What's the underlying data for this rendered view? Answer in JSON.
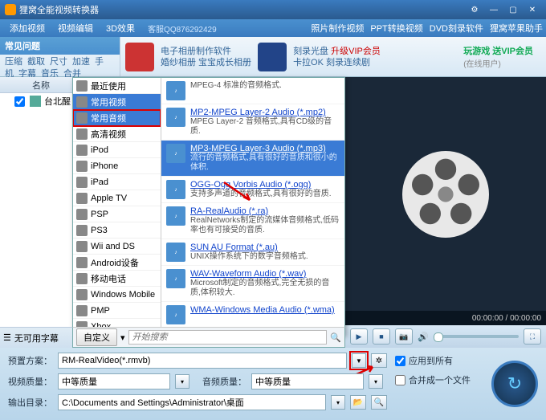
{
  "title": "狸窝全能视频转换器",
  "menu": {
    "addVideo": "添加视频",
    "videoEdit": "视频编辑",
    "effect3d": "3D效果"
  },
  "support": "客服QQ876292429",
  "topLinks": {
    "photo": "照片制作视频",
    "ppt": "PPT转换视频",
    "dvd": "DVD刻录软件",
    "apple": "狸窝苹果助手"
  },
  "faq": {
    "title": "常见问题",
    "items": [
      "压缩",
      "截取",
      "尺寸",
      "加速",
      "手机",
      "字幕",
      "音乐",
      "合并"
    ]
  },
  "promo1": {
    "line1": "电子相册制作软件",
    "line2": "婚纱相册  宝宝成长相册"
  },
  "promo2": {
    "line1": "刻录光盘",
    "vip": "升级VIP会员",
    "line2": "卡拉OK  刻录连续剧"
  },
  "promo3": {
    "line1": "玩游戏  送VIP会员",
    "line2": "(在线用户)"
  },
  "nameHeader": "名称",
  "fileItem": "台北醒",
  "categories": [
    {
      "label": "最近使用"
    },
    {
      "label": "常用视频",
      "hl": true
    },
    {
      "label": "常用音频",
      "hlRed": true
    },
    {
      "label": "高清视频"
    },
    {
      "label": "iPod"
    },
    {
      "label": "iPhone"
    },
    {
      "label": "iPad"
    },
    {
      "label": "Apple TV"
    },
    {
      "label": "PSP"
    },
    {
      "label": "PS3"
    },
    {
      "label": "Wii and DS"
    },
    {
      "label": "Android设备"
    },
    {
      "label": "移动电话"
    },
    {
      "label": "Windows Mobile"
    },
    {
      "label": "PMP"
    },
    {
      "label": "Xbox"
    }
  ],
  "formats": [
    {
      "title": "",
      "desc": "MPEG-4 标准的音频格式."
    },
    {
      "title": "MP2-MPEG Layer-2 Audio (*.mp2)",
      "desc": "MPEG Layer-2 音频格式,具有CD级的音质."
    },
    {
      "title": "MP3-MPEG Layer-3 Audio (*.mp3)",
      "desc": "流行的音频格式,具有很好的音质和很小的体积.",
      "sel": true
    },
    {
      "title": "OGG-Ogg Vorbis Audio (*.ogg)",
      "desc": "支持多声道的音频格式,具有很好的音质."
    },
    {
      "title": "RA-RealAudio (*.ra)",
      "desc": "RealNetworks制定的流媒体音频格式,低码率也有可接受的音质."
    },
    {
      "title": "SUN AU Format (*.au)",
      "desc": "UNIX操作系统下的数字音频格式."
    },
    {
      "title": "WAV-Waveform Audio (*.wav)",
      "desc": "Microsoft制定的音频格式,完全无损的音质,体积较大."
    },
    {
      "title": "WMA-Windows Media Audio (*.wma)",
      "desc": ""
    }
  ],
  "ddFooter": {
    "custom": "自定义",
    "searchPlaceholder": "开始搜索"
  },
  "noSubtitle": "无可用字幕",
  "time": "00:00:00 / 00:00:00",
  "settings": {
    "presetLabel": "预置方案：",
    "presetValue": "RM-RealVideo(*.rmvb)",
    "vqLabel": "视频质量：",
    "vqValue": "中等质量",
    "aqLabel": "音频质量：",
    "aqValue": "中等质量",
    "outLabel": "输出目录：",
    "outValue": "C:\\Documents and Settings\\Administrator\\桌面"
  },
  "checks": {
    "applyAll": "应用到所有",
    "mergeOne": "合并成一个文件"
  }
}
